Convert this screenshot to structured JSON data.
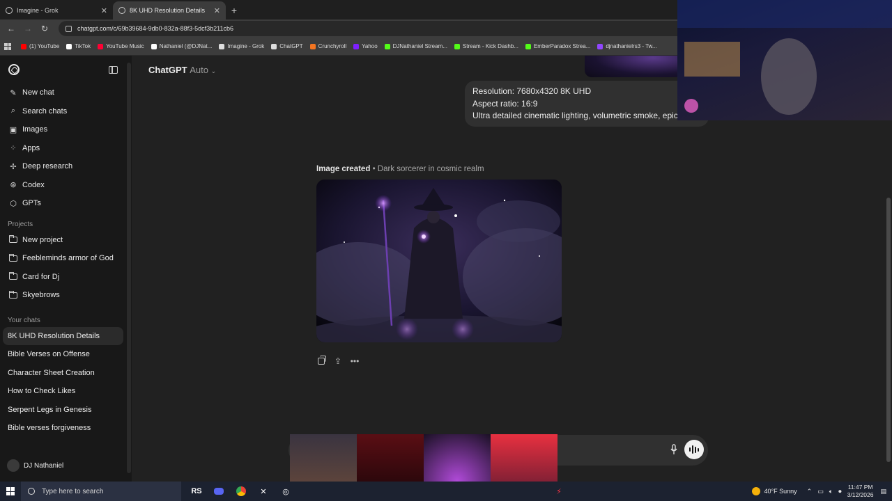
{
  "browser": {
    "tabs": [
      {
        "title": "Imagine - Grok",
        "active": false
      },
      {
        "title": "8K UHD Resolution Details",
        "active": true
      }
    ],
    "url": "chatgpt.com/c/69b39684-9db0-832a-88f3-5dcf3b211cb6",
    "bookmarks": [
      {
        "label": "(1) YouTube",
        "color": "#ff0000"
      },
      {
        "label": "TikTok",
        "color": "#ffffff"
      },
      {
        "label": "YouTube Music",
        "color": "#ff0033"
      },
      {
        "label": "Nathaniel (@DJNat...",
        "color": "#ffffff"
      },
      {
        "label": "Imagine - Grok",
        "color": "#dddddd"
      },
      {
        "label": "ChatGPT",
        "color": "#dddddd"
      },
      {
        "label": "Crunchyroll",
        "color": "#f47521"
      },
      {
        "label": "Yahoo",
        "color": "#7e1fff"
      },
      {
        "label": "DJNathaniel Stream...",
        "color": "#53fc18"
      },
      {
        "label": "Stream - Kick Dashb...",
        "color": "#53fc18"
      },
      {
        "label": "EmberParadox Strea...",
        "color": "#53fc18"
      },
      {
        "label": "djnathanielrs3 - Tw...",
        "color": "#9146ff"
      }
    ]
  },
  "sidebar": {
    "nav": [
      {
        "label": "New chat",
        "icon": "edit-icon",
        "glyph": "✎"
      },
      {
        "label": "Search chats",
        "icon": "search-icon",
        "glyph": "⌕"
      },
      {
        "label": "Images",
        "icon": "image-icon",
        "glyph": "▣"
      },
      {
        "label": "Apps",
        "icon": "apps-icon",
        "glyph": "⁘"
      },
      {
        "label": "Deep research",
        "icon": "research-icon",
        "glyph": "✢"
      },
      {
        "label": "Codex",
        "icon": "codex-icon",
        "glyph": "⊛"
      },
      {
        "label": "GPTs",
        "icon": "gpts-icon",
        "glyph": "⬡"
      }
    ],
    "projects_heading": "Projects",
    "projects": [
      {
        "label": "New project",
        "icon": "new-folder-icon"
      },
      {
        "label": "Feebleminds armor of God",
        "icon": "folder-icon"
      },
      {
        "label": "Card for Dj",
        "icon": "folder-icon"
      },
      {
        "label": "Skyebrows",
        "icon": "folder-icon"
      }
    ],
    "chats_heading": "Your chats",
    "chats": [
      "8K UHD Resolution Details",
      "Bible Verses on Offense",
      "Character Sheet Creation",
      "How to Check Likes",
      "Serpent Legs in Genesis",
      "Bible verses forgiveness"
    ],
    "user": "DJ Nathaniel"
  },
  "main": {
    "model_name": "ChatGPT",
    "model_mode": "Auto",
    "user_message_lines": [
      "Resolution: 7680x4320 8K UHD",
      "Aspect ratio: 16:9",
      "Ultra detailed cinematic lighting, volumetric smoke, epic s"
    ],
    "image_status": "Image created",
    "image_title": "Dark sorcerer in cosmic realm"
  },
  "taskbar": {
    "search_placeholder": "Type here to search",
    "weather": "40°F  Sunny",
    "time": "11:47 PM",
    "date": "3/12/2026"
  }
}
